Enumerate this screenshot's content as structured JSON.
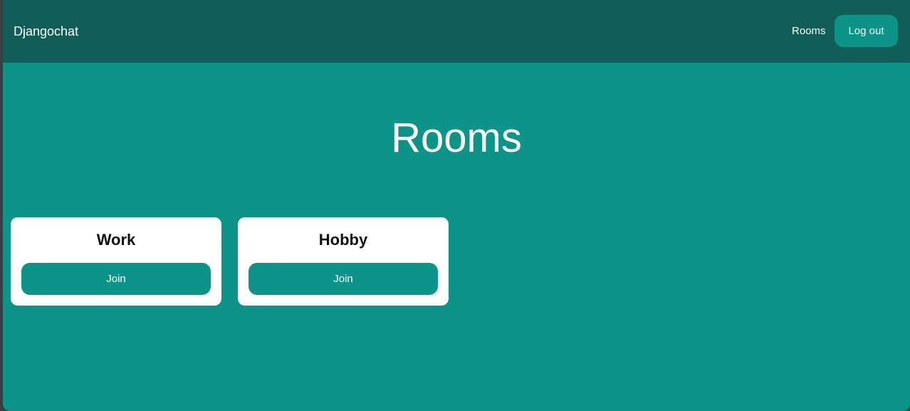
{
  "navbar": {
    "brand": "Djangochat",
    "rooms_link": "Rooms",
    "logout_label": "Log out"
  },
  "main": {
    "title": "Rooms",
    "rooms": [
      {
        "name": "Work",
        "join_label": "Join"
      },
      {
        "name": "Hobby",
        "join_label": "Join"
      }
    ]
  },
  "colors": {
    "navbar_bg": "#115e59",
    "page_bg": "#0d9488",
    "button_bg": "#0d9488",
    "card_bg": "#ffffff"
  }
}
